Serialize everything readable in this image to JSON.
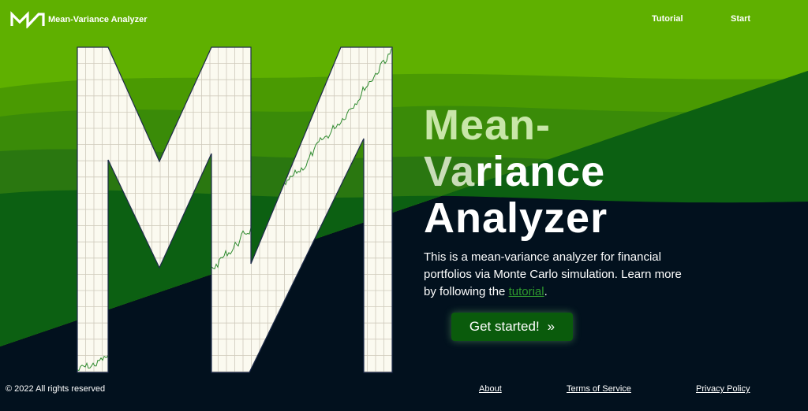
{
  "nav": {
    "app_title": "Mean-Variance Analyzer",
    "tutorial": "Tutorial",
    "start": "Start"
  },
  "hero": {
    "title_line1": "Mean-",
    "title_line2_a": "Va",
    "title_line2_b": "riance",
    "title_line3": "Analyzer",
    "desc_before": "This is a mean-variance analyzer for financial portfolios via Monte Carlo simulation. Learn more by following the ",
    "desc_link": "tutorial",
    "desc_after": ".",
    "cta_label": "Get started!",
    "cta_icon": "»"
  },
  "footer": {
    "copyright": "© 2022 All rights reserved",
    "about": "About",
    "terms": "Terms of Service",
    "privacy": "Privacy Policy"
  },
  "colors": {
    "navy": "#02111e",
    "green_bright": "#5fb000",
    "green_mid": "#3a8c08",
    "green_dark": "#0c6012",
    "paper": "#fbfaf0",
    "cta_bg": "#0a5b0c"
  }
}
